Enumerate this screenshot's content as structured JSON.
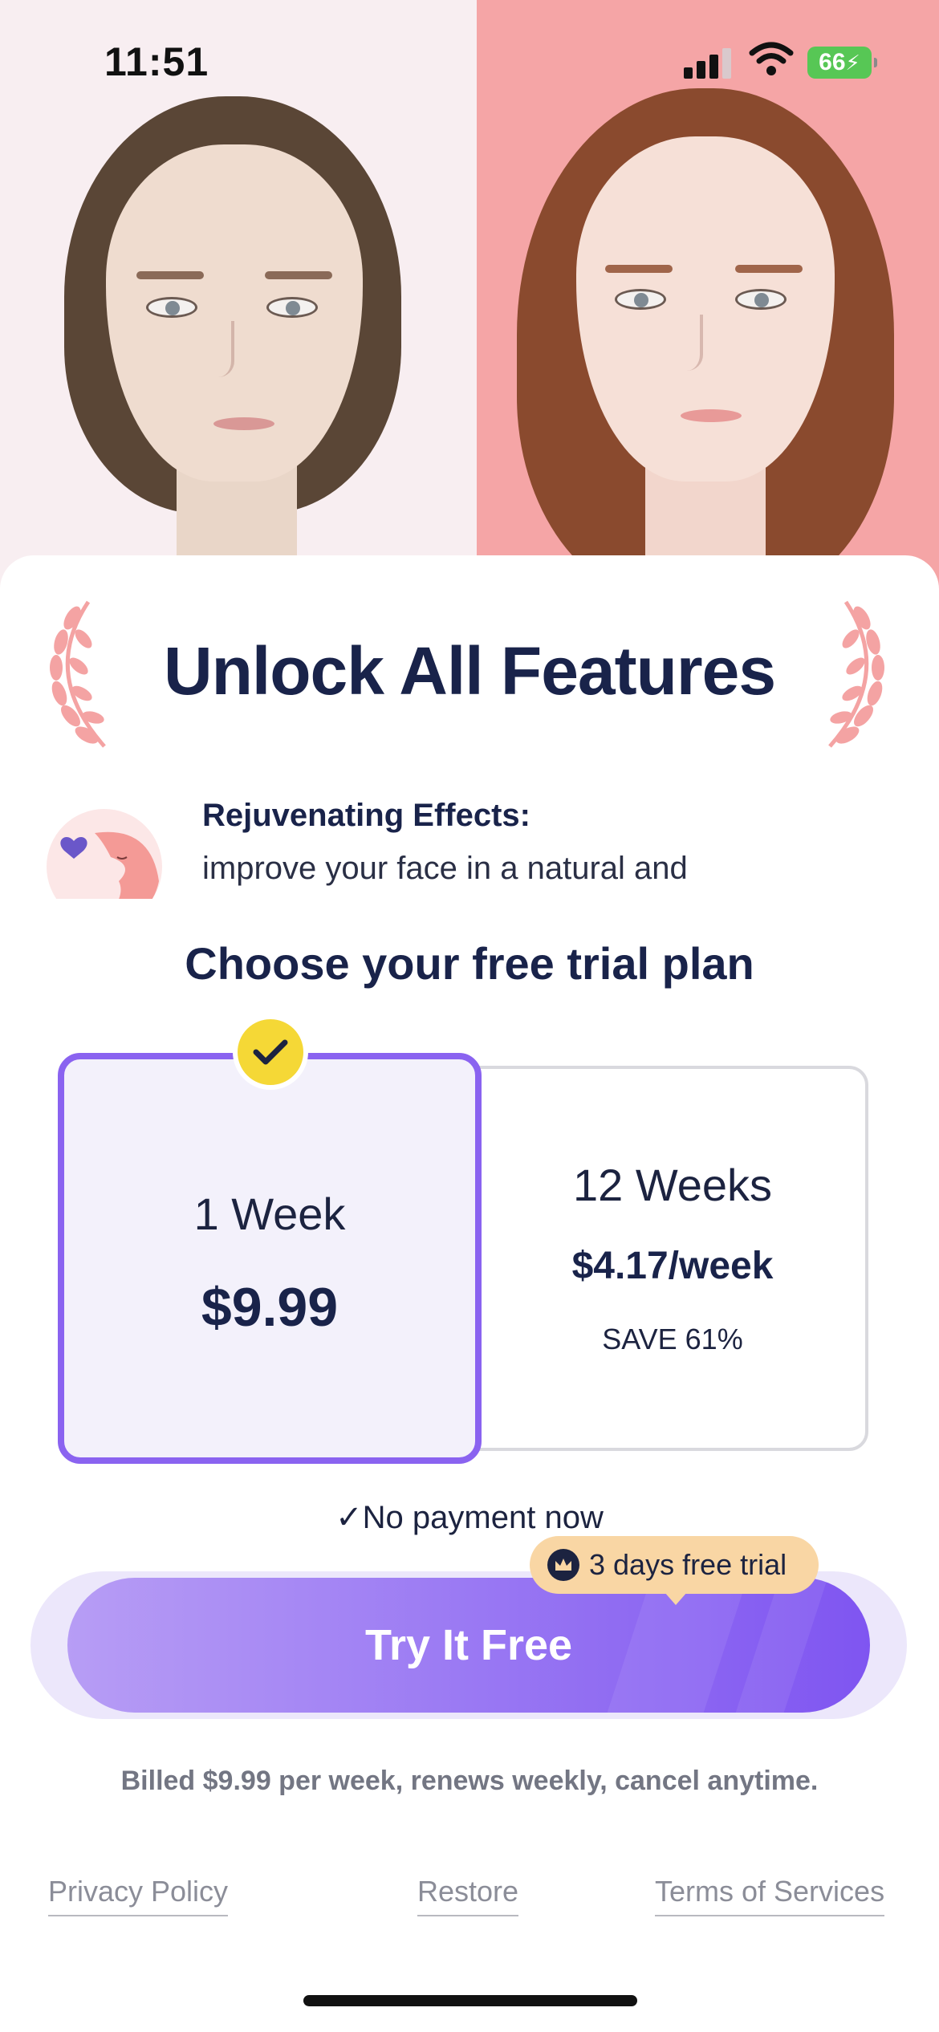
{
  "status_bar": {
    "time": "11:51",
    "battery": "66",
    "icons": [
      "signal-icon",
      "wifi-icon",
      "battery-charging-icon"
    ]
  },
  "hero": {
    "left_background": "#f8eef1",
    "right_background": "#f5a5a6"
  },
  "title": "Unlock All Features",
  "feature": {
    "title": "Rejuvenating Effects:",
    "description": "improve your face in a natural and"
  },
  "plans": {
    "heading": "Choose your free trial plan",
    "options": [
      {
        "name": "1 Week",
        "price": "$9.99",
        "selected": true
      },
      {
        "name": "12 Weeks",
        "price": "$4.17/week",
        "save": "SAVE 61%",
        "selected": false
      }
    ]
  },
  "no_payment": "No payment now",
  "trial_badge": "3 days free trial",
  "cta": {
    "label": "Try It Free"
  },
  "billing_note": "Billed $9.99 per week, renews weekly, cancel anytime.",
  "footer": {
    "privacy": "Privacy Policy",
    "restore": "Restore",
    "terms": "Terms of Services"
  },
  "colors": {
    "accent": "#8a63f0",
    "title": "#19234a",
    "badge": "#f5d836",
    "trial_pill": "#f9d6a4",
    "laurel": "#f4a3a3"
  }
}
